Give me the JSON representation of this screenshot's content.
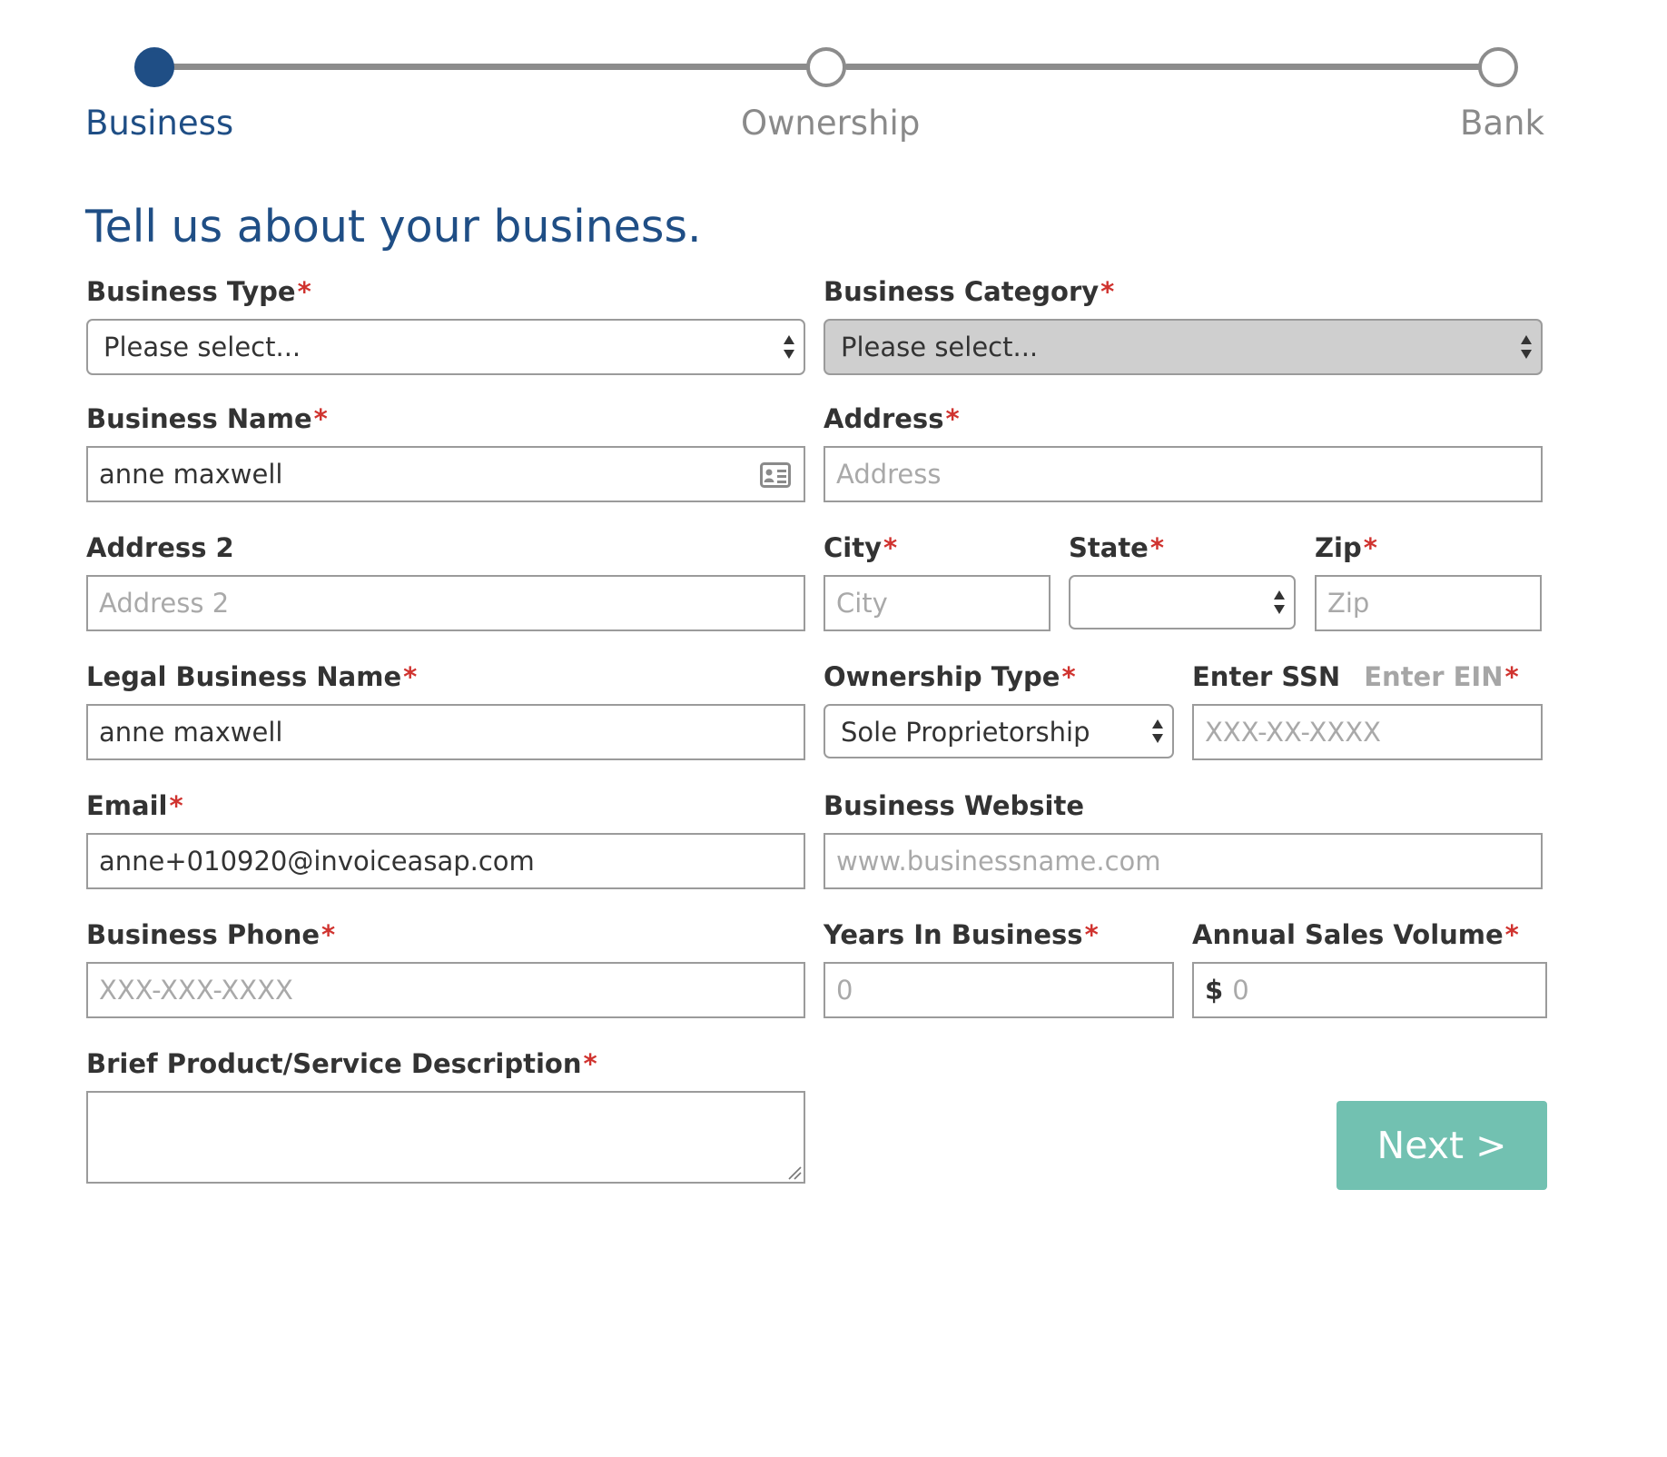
{
  "stepper": {
    "steps": [
      {
        "label": "Business",
        "state": "active"
      },
      {
        "label": "Ownership",
        "state": "inactive"
      },
      {
        "label": "Bank",
        "state": "inactive"
      }
    ]
  },
  "page_title": "Tell us about your business.",
  "required_mark": "*",
  "form": {
    "business_type": {
      "label": "Business Type",
      "value": "Please select..."
    },
    "business_category": {
      "label": "Business Category",
      "value": "Please select...",
      "disabled": true
    },
    "business_name": {
      "label": "Business Name",
      "value": "anne maxwell",
      "icon": "contact-card-icon"
    },
    "address": {
      "label": "Address",
      "placeholder": "Address"
    },
    "address2": {
      "label": "Address 2",
      "placeholder": "Address 2"
    },
    "city": {
      "label": "City",
      "placeholder": "City"
    },
    "state": {
      "label": "State",
      "value": ""
    },
    "zip": {
      "label": "Zip",
      "placeholder": "Zip"
    },
    "legal_business_name": {
      "label": "Legal Business Name",
      "value": "anne maxwell"
    },
    "ownership_type": {
      "label": "Ownership Type",
      "value": "Sole Proprietorship"
    },
    "tax_id": {
      "label_ssn": "Enter SSN",
      "label_ein": "Enter EIN",
      "placeholder": "XXX-XX-XXXX"
    },
    "email": {
      "label": "Email",
      "value": "anne+010920@invoiceasap.com"
    },
    "business_website": {
      "label": "Business Website",
      "placeholder": "www.businessname.com"
    },
    "business_phone": {
      "label": "Business Phone",
      "placeholder": "XXX-XXX-XXXX"
    },
    "years_in_business": {
      "label": "Years In Business",
      "placeholder": "0"
    },
    "annual_sales_volume": {
      "label": "Annual Sales Volume",
      "currency": "$",
      "placeholder": "0"
    },
    "description": {
      "label": "Brief Product/Service Description",
      "value": ""
    }
  },
  "next_button": {
    "label": "Next >"
  },
  "colors": {
    "primary": "#1f4e85",
    "required": "#d0332f",
    "button": "#72c1b1",
    "disabled_field": "#cfcfcf",
    "inactive_step": "#8c8c8c"
  }
}
